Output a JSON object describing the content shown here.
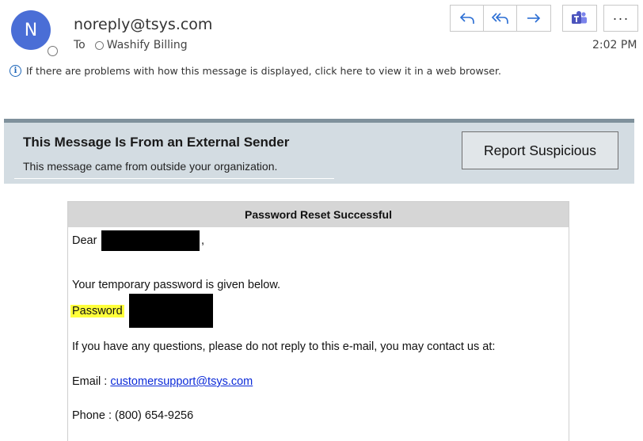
{
  "message_header": {
    "avatar_initial": "N",
    "sender": "noreply@tsys.com",
    "to_label": "To",
    "recipient": "Washify Billing",
    "time": "2:02 PM",
    "info_text": "If there are problems with how this message is displayed, click here to view it in a web browser."
  },
  "toolbar": {
    "icons": [
      "reply-icon",
      "reply-all-icon",
      "forward-icon",
      "teams-icon",
      "more-icon"
    ],
    "more_label": "···"
  },
  "banner": {
    "title": "This Message Is From an External Sender",
    "subtitle": "This message came from outside your organization.",
    "report_button": "Report Suspicious"
  },
  "email": {
    "header": "Password Reset Successful",
    "greeting": "Dear",
    "greeting_comma": ",",
    "temp_line": "Your temporary password is given below.",
    "password_label": "Password",
    "questions_line": "If you have any questions, please do not reply to this e-mail, you may contact us at:",
    "email_label": "Email : ",
    "email_address": "customersupport@tsys.com",
    "phone_line": "Phone : (800) 654-9256"
  },
  "colors": {
    "avatar": "#4a6ed6",
    "banner_bg": "#d3dce2",
    "banner_border": "#7f919c",
    "highlight": "#ffff3a",
    "link": "#0b2ad8",
    "toolbar_icon": "#2b6ed4",
    "teams": "#5059c9"
  }
}
